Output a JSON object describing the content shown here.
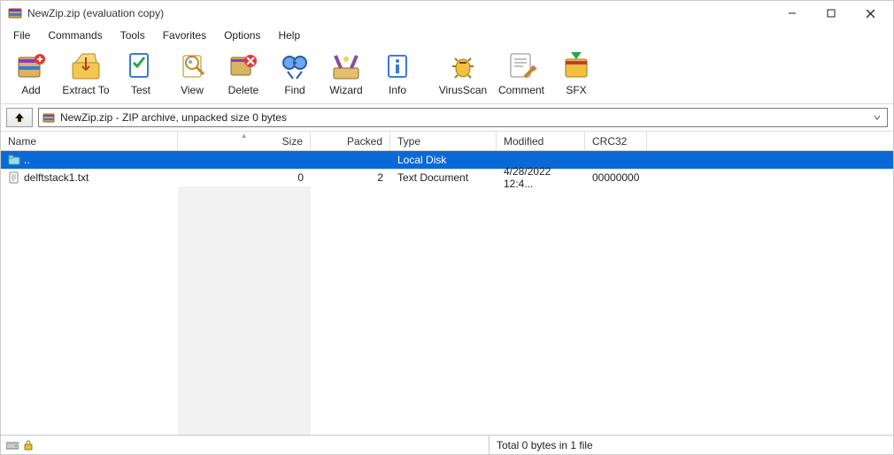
{
  "title": "NewZip.zip (evaluation copy)",
  "menu": [
    "File",
    "Commands",
    "Tools",
    "Favorites",
    "Options",
    "Help"
  ],
  "toolbar": [
    {
      "id": "add",
      "label": "Add"
    },
    {
      "id": "extract",
      "label": "Extract To"
    },
    {
      "id": "test",
      "label": "Test"
    },
    {
      "id": "view",
      "label": "View"
    },
    {
      "id": "delete",
      "label": "Delete"
    },
    {
      "id": "find",
      "label": "Find"
    },
    {
      "id": "wizard",
      "label": "Wizard"
    },
    {
      "id": "info",
      "label": "Info"
    },
    {
      "id": "virusscan",
      "label": "VirusScan"
    },
    {
      "id": "comment",
      "label": "Comment"
    },
    {
      "id": "sfx",
      "label": "SFX"
    }
  ],
  "address": "NewZip.zip - ZIP archive, unpacked size 0 bytes",
  "columns": {
    "name": "Name",
    "size": "Size",
    "packed": "Packed",
    "type": "Type",
    "modified": "Modified",
    "crc32": "CRC32"
  },
  "rows": [
    {
      "name": "..",
      "size": "",
      "packed": "",
      "type": "Local Disk",
      "modified": "",
      "crc32": "",
      "selected": true,
      "icon": "folder-up"
    },
    {
      "name": "delftstack1.txt",
      "size": "0",
      "packed": "2",
      "type": "Text Document",
      "modified": "4/28/2022 12:4...",
      "crc32": "00000000",
      "selected": false,
      "icon": "text-file"
    }
  ],
  "status": {
    "total": "Total 0 bytes in 1 file"
  }
}
